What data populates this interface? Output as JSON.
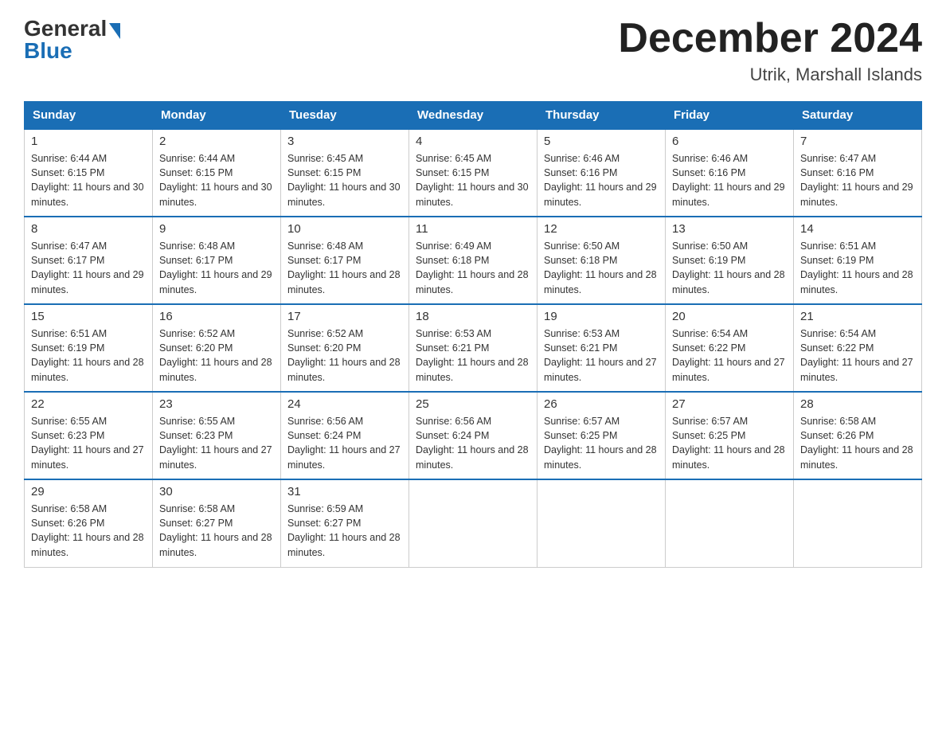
{
  "header": {
    "logo_general": "General",
    "logo_blue": "Blue",
    "month_title": "December 2024",
    "location": "Utrik, Marshall Islands"
  },
  "weekdays": [
    "Sunday",
    "Monday",
    "Tuesday",
    "Wednesday",
    "Thursday",
    "Friday",
    "Saturday"
  ],
  "weeks": [
    [
      {
        "day": "1",
        "sunrise": "6:44 AM",
        "sunset": "6:15 PM",
        "daylight": "11 hours and 30 minutes."
      },
      {
        "day": "2",
        "sunrise": "6:44 AM",
        "sunset": "6:15 PM",
        "daylight": "11 hours and 30 minutes."
      },
      {
        "day": "3",
        "sunrise": "6:45 AM",
        "sunset": "6:15 PM",
        "daylight": "11 hours and 30 minutes."
      },
      {
        "day": "4",
        "sunrise": "6:45 AM",
        "sunset": "6:15 PM",
        "daylight": "11 hours and 30 minutes."
      },
      {
        "day": "5",
        "sunrise": "6:46 AM",
        "sunset": "6:16 PM",
        "daylight": "11 hours and 29 minutes."
      },
      {
        "day": "6",
        "sunrise": "6:46 AM",
        "sunset": "6:16 PM",
        "daylight": "11 hours and 29 minutes."
      },
      {
        "day": "7",
        "sunrise": "6:47 AM",
        "sunset": "6:16 PM",
        "daylight": "11 hours and 29 minutes."
      }
    ],
    [
      {
        "day": "8",
        "sunrise": "6:47 AM",
        "sunset": "6:17 PM",
        "daylight": "11 hours and 29 minutes."
      },
      {
        "day": "9",
        "sunrise": "6:48 AM",
        "sunset": "6:17 PM",
        "daylight": "11 hours and 29 minutes."
      },
      {
        "day": "10",
        "sunrise": "6:48 AM",
        "sunset": "6:17 PM",
        "daylight": "11 hours and 28 minutes."
      },
      {
        "day": "11",
        "sunrise": "6:49 AM",
        "sunset": "6:18 PM",
        "daylight": "11 hours and 28 minutes."
      },
      {
        "day": "12",
        "sunrise": "6:50 AM",
        "sunset": "6:18 PM",
        "daylight": "11 hours and 28 minutes."
      },
      {
        "day": "13",
        "sunrise": "6:50 AM",
        "sunset": "6:19 PM",
        "daylight": "11 hours and 28 minutes."
      },
      {
        "day": "14",
        "sunrise": "6:51 AM",
        "sunset": "6:19 PM",
        "daylight": "11 hours and 28 minutes."
      }
    ],
    [
      {
        "day": "15",
        "sunrise": "6:51 AM",
        "sunset": "6:19 PM",
        "daylight": "11 hours and 28 minutes."
      },
      {
        "day": "16",
        "sunrise": "6:52 AM",
        "sunset": "6:20 PM",
        "daylight": "11 hours and 28 minutes."
      },
      {
        "day": "17",
        "sunrise": "6:52 AM",
        "sunset": "6:20 PM",
        "daylight": "11 hours and 28 minutes."
      },
      {
        "day": "18",
        "sunrise": "6:53 AM",
        "sunset": "6:21 PM",
        "daylight": "11 hours and 28 minutes."
      },
      {
        "day": "19",
        "sunrise": "6:53 AM",
        "sunset": "6:21 PM",
        "daylight": "11 hours and 27 minutes."
      },
      {
        "day": "20",
        "sunrise": "6:54 AM",
        "sunset": "6:22 PM",
        "daylight": "11 hours and 27 minutes."
      },
      {
        "day": "21",
        "sunrise": "6:54 AM",
        "sunset": "6:22 PM",
        "daylight": "11 hours and 27 minutes."
      }
    ],
    [
      {
        "day": "22",
        "sunrise": "6:55 AM",
        "sunset": "6:23 PM",
        "daylight": "11 hours and 27 minutes."
      },
      {
        "day": "23",
        "sunrise": "6:55 AM",
        "sunset": "6:23 PM",
        "daylight": "11 hours and 27 minutes."
      },
      {
        "day": "24",
        "sunrise": "6:56 AM",
        "sunset": "6:24 PM",
        "daylight": "11 hours and 27 minutes."
      },
      {
        "day": "25",
        "sunrise": "6:56 AM",
        "sunset": "6:24 PM",
        "daylight": "11 hours and 28 minutes."
      },
      {
        "day": "26",
        "sunrise": "6:57 AM",
        "sunset": "6:25 PM",
        "daylight": "11 hours and 28 minutes."
      },
      {
        "day": "27",
        "sunrise": "6:57 AM",
        "sunset": "6:25 PM",
        "daylight": "11 hours and 28 minutes."
      },
      {
        "day": "28",
        "sunrise": "6:58 AM",
        "sunset": "6:26 PM",
        "daylight": "11 hours and 28 minutes."
      }
    ],
    [
      {
        "day": "29",
        "sunrise": "6:58 AM",
        "sunset": "6:26 PM",
        "daylight": "11 hours and 28 minutes."
      },
      {
        "day": "30",
        "sunrise": "6:58 AM",
        "sunset": "6:27 PM",
        "daylight": "11 hours and 28 minutes."
      },
      {
        "day": "31",
        "sunrise": "6:59 AM",
        "sunset": "6:27 PM",
        "daylight": "11 hours and 28 minutes."
      },
      null,
      null,
      null,
      null
    ]
  ]
}
